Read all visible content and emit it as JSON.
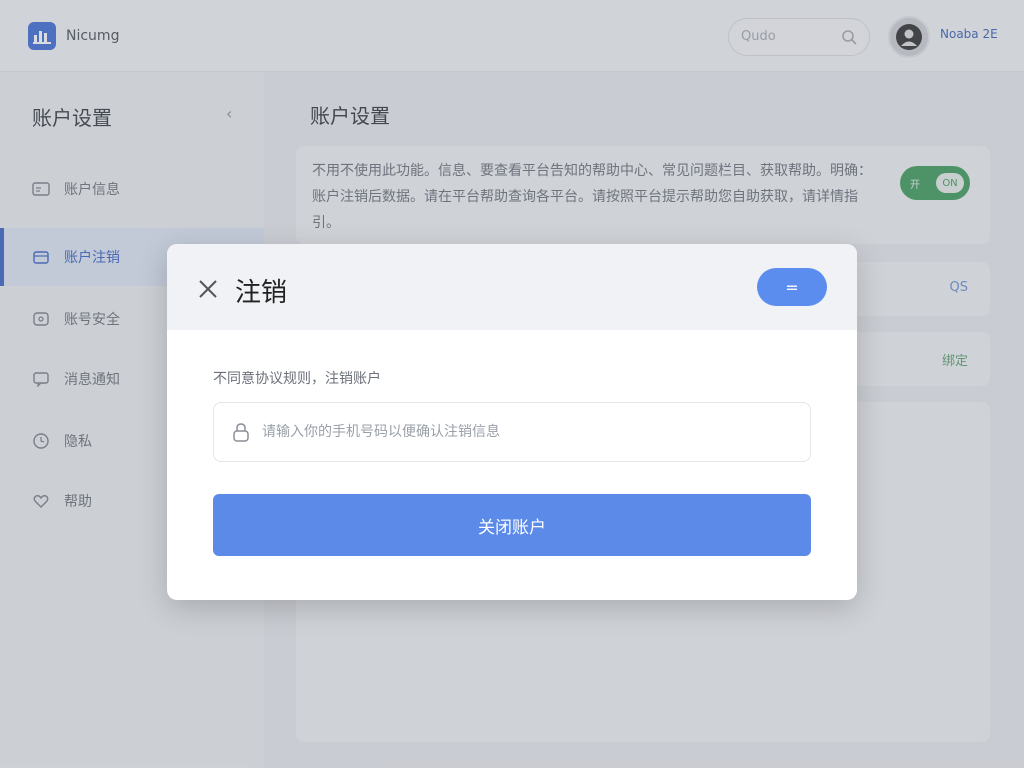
{
  "header": {
    "app_name": "Nicumg",
    "search_placeholder": "Qudo",
    "username": "Noaba 2E"
  },
  "sidebar": {
    "title": "账户设置",
    "collapse_icon": "chevron-left-icon",
    "items": [
      {
        "label": "账户信息",
        "icon": "id-card-icon"
      },
      {
        "label": "账户注销",
        "icon": "box-icon"
      },
      {
        "label": "账号安全",
        "icon": "lock-square-icon"
      },
      {
        "label": "消息通知",
        "icon": "message-icon"
      },
      {
        "label": "隐私",
        "icon": "clock-icon"
      },
      {
        "label": "帮助",
        "icon": "heart-icon"
      }
    ],
    "active_index": 1
  },
  "main": {
    "title": "账户设置",
    "card_text": "不用不使用此功能。信息、要查看平台告知的帮助中心、常见问题栏目、获取帮助。明确：账户注销后数据。请在平台帮助查询各平台。请按照平台提示帮助您自助获取，请详情指引。",
    "toggle_label": "开",
    "toggle_knob": "ON",
    "row2_value": "QS",
    "row3_value": "绑定"
  },
  "modal": {
    "title": "注销",
    "menu_button": "=",
    "description": "不同意协议规则，注销账户",
    "input_placeholder": "请输入你的手机号码以便确认注销信息",
    "submit_label": "关闭账户"
  },
  "colors": {
    "accent": "#5b8ae8",
    "active_nav": "#3a63c5",
    "toggle_on": "#3f9b5a"
  }
}
